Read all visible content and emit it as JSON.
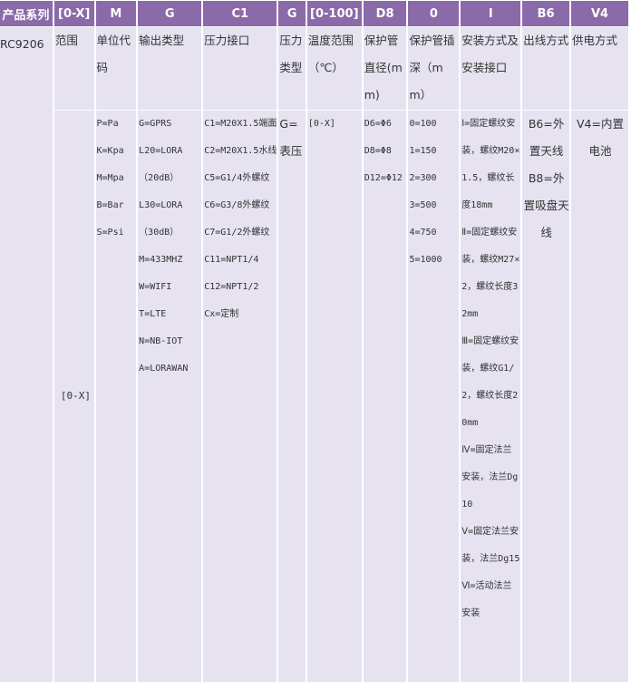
{
  "headers": [
    "产品系列",
    "[0-X]",
    "M",
    "G",
    "C1",
    "G",
    "[0-100]",
    "D8",
    "0",
    "I",
    "B6",
    "V4"
  ],
  "labels": {
    "series": "RC9206",
    "range": "范围",
    "unit": "单位代码",
    "output": "输出类型",
    "interface": "压力接口",
    "ptype": "压力类型",
    "temp": "温度范围（℃）",
    "dia": "保护管直径(mm)",
    "depth": "保护管插深（mm）",
    "install": "安装方式及安装接口",
    "outlet": "出线方式",
    "power": "供电方式"
  },
  "values": {
    "range": "[0-X]",
    "unit": [
      "P=Pa",
      "K=Kpa",
      "M=Mpa",
      "B=Bar",
      "S=Psi"
    ],
    "output": [
      "G=GPRS",
      "L20=LORA",
      "（20dB）",
      "L30=LORA",
      "（30dB）",
      "M=433MHZ",
      "W=WIFI",
      "T=LTE",
      "N=NB-IOT",
      "A=LORAWAN"
    ],
    "interface": [
      "C1=M20X1.5端面",
      "C2=M20X1.5水线",
      "C5=G1/4外螺纹",
      "C6=G3/8外螺纹",
      "C7=G1/2外螺纹",
      "C11=NPT1/4",
      "C12=NPT1/2",
      "Cx=定制"
    ],
    "ptype": "G=表压",
    "temp": "[0-X]",
    "dia": [
      "D6=Φ6",
      "D8=Φ8",
      "D12=Φ12"
    ],
    "depth": [
      "0=100",
      "1=150",
      "2=300",
      "3=500",
      "4=750",
      "5=1000"
    ],
    "install": [
      "Ⅰ=固定螺纹安装，螺纹M20×1.5，螺纹长度18mm",
      "Ⅱ=固定螺纹安装，螺纹M27×2，螺纹长度32mm",
      "Ⅲ=固定螺纹安装，螺纹G1/2，螺纹长度20mm",
      "Ⅳ=固定法兰安装，法兰Dg10",
      "Ⅴ=固定法兰安装，法兰Dg15",
      "Ⅵ=活动法兰安装"
    ],
    "outlet": [
      "B6=外置天线",
      "B8=外置吸盘天线"
    ],
    "power": "V4=内置电池"
  }
}
